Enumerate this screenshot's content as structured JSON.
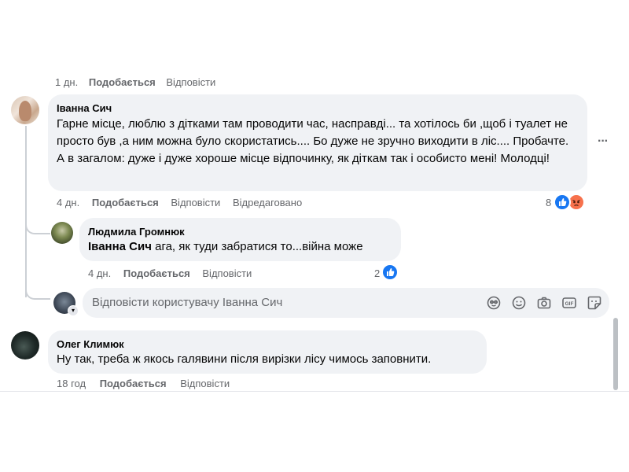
{
  "comments": [
    {
      "top_meta": {
        "time": "1 дн.",
        "like": "Подобається",
        "reply": "Відповісти"
      }
    },
    {
      "author": "Іванна Сич",
      "text": "Гарне місце, люблю з дітками там проводити час, насправді... та хотілось би ,щоб і туалет не просто був ,а ним можна було скористатись.... Бо дуже не зручно виходити в ліс.... Пробачте. А в загалом: дуже і дуже хороше місце відпочинку, як діткам так і особисто мені! Молодці!",
      "time": "4 дн.",
      "like": "Подобається",
      "reply": "Відповісти",
      "edited": "Відредаговано",
      "reaction_count": "8",
      "more": "···"
    },
    {
      "author": "Людмила Громнюк",
      "mention": "Іванна Сич",
      "text": " ага, як туди забратися то...війна може",
      "time": "4 дн.",
      "like": "Подобається",
      "reply": "Відповісти",
      "reaction_count": "2"
    },
    {
      "author": "Олег Климюк",
      "text": "Ну так, треба ж якось галявини після вирізки лісу чимось заповнити.",
      "time": "18 год",
      "like": "Подобається",
      "reply": "Відповісти"
    }
  ],
  "reply_box": {
    "placeholder": "Відповісти користувачу Іванна Сич",
    "icons": [
      "avatar-sticker-icon",
      "emoji-icon",
      "camera-icon",
      "gif-icon",
      "sticker-icon"
    ]
  },
  "colors": {
    "like_blue": "#1877f2",
    "angry_orange": "#f7714c",
    "meta_gray": "#65676b",
    "bubble": "#f0f2f5"
  }
}
